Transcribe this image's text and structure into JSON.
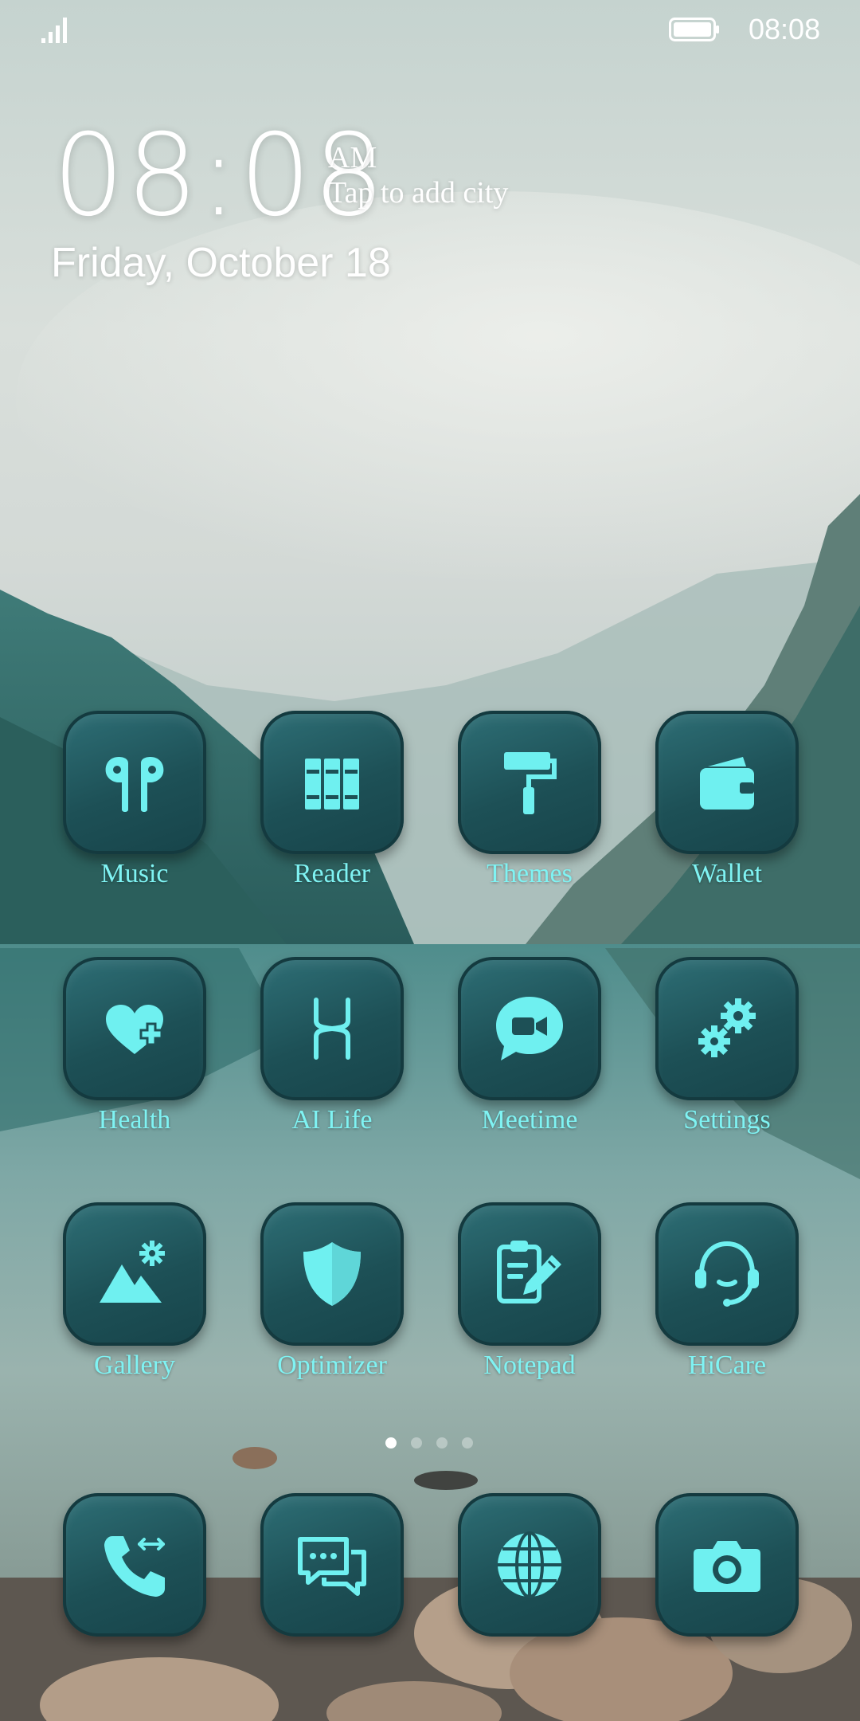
{
  "status_bar": {
    "time": "08:08",
    "signal_icon": "signal-icon",
    "battery_icon": "battery-icon"
  },
  "lock_widget": {
    "clock": "08:08",
    "ampm": "AM",
    "weather_prompt": "Tap to add city",
    "date": "Friday, October 18"
  },
  "apps": [
    {
      "label": "Music",
      "icon": "earbuds-icon"
    },
    {
      "label": "Reader",
      "icon": "books-icon"
    },
    {
      "label": "Themes",
      "icon": "paint-roller-icon"
    },
    {
      "label": "Wallet",
      "icon": "wallet-icon"
    },
    {
      "label": "Health",
      "icon": "heart-plus-icon"
    },
    {
      "label": "AI Life",
      "icon": "ai-life-icon"
    },
    {
      "label": "Meetime",
      "icon": "video-chat-icon"
    },
    {
      "label": "Settings",
      "icon": "gears-icon"
    },
    {
      "label": "Gallery",
      "icon": "mountain-icon"
    },
    {
      "label": "Optimizer",
      "icon": "shield-icon"
    },
    {
      "label": "Notepad",
      "icon": "notepad-icon"
    },
    {
      "label": "HiCare",
      "icon": "headset-icon"
    }
  ],
  "page_indicator": {
    "pages": 4,
    "current": 1
  },
  "dock": [
    {
      "icon": "phone-icon"
    },
    {
      "icon": "messages-icon"
    },
    {
      "icon": "browser-icon"
    },
    {
      "icon": "camera-icon"
    }
  ],
  "colors": {
    "icon_glyph": "#6ff0f0",
    "tile": "#1f5459",
    "label": "#7ff3f3"
  }
}
